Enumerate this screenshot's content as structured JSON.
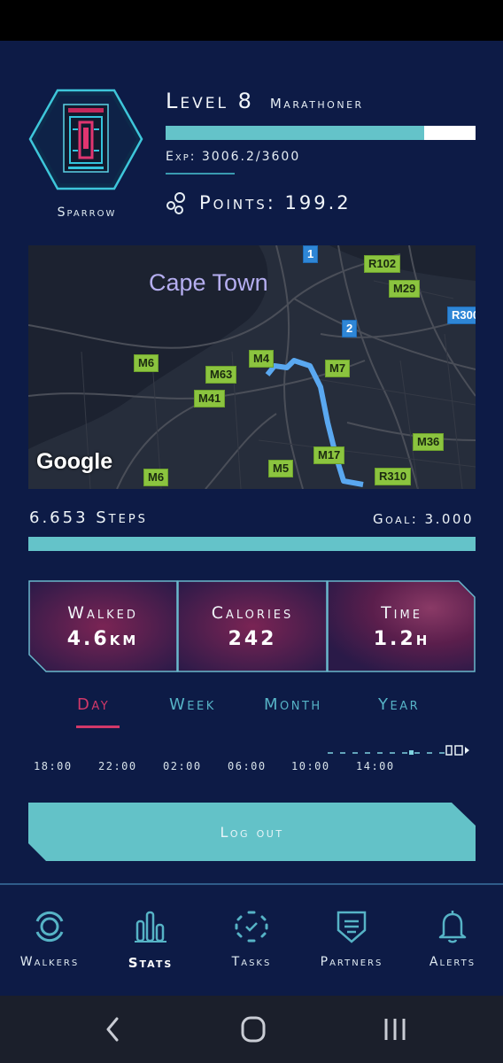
{
  "profile": {
    "username": "Sparrow",
    "level": "Level 8",
    "rank": "Marathoner",
    "exp_text": "Exp: 3006.2/3600",
    "exp_fraction": 0.835,
    "points_text": "Points: 199.2"
  },
  "map": {
    "city": "Cape Town",
    "attribution": "Google",
    "road_labels": [
      "1",
      "R102",
      "M29",
      "R300",
      "2",
      "M6",
      "M63",
      "M4",
      "M7",
      "M41",
      "M36",
      "M17",
      "M5",
      "R310",
      "M6"
    ]
  },
  "steps": {
    "steps_text": "6.653 Steps",
    "goal_text": "Goal: 3.000",
    "progress_fraction": 1.0
  },
  "stats": {
    "walked_label": "Walked",
    "walked_value": "4.6km",
    "calories_label": "Calories",
    "calories_value": "242",
    "time_label": "Time",
    "time_value": "1.2h"
  },
  "tabs": [
    "Day",
    "Week",
    "Month",
    "Year"
  ],
  "active_tab": "Day",
  "chart": {
    "time_labels": [
      "18:00",
      "22:00",
      "02:00",
      "06:00",
      "10:00",
      "14:00"
    ]
  },
  "logout_label": "Log out",
  "nav": {
    "walkers": "Walkers",
    "stats": "Stats",
    "tasks": "Tasks",
    "partners": "Partners",
    "alerts": "Alerts"
  },
  "colors": {
    "background": "#0d1b46",
    "accent_teal": "#64c3c9",
    "accent_pink": "#d23869",
    "route_blue": "#5aa8f0"
  }
}
